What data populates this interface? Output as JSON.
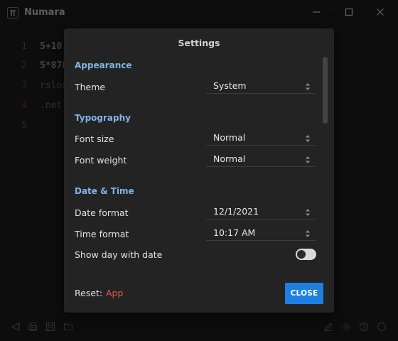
{
  "window": {
    "title": "Numara"
  },
  "editor": {
    "lines": [
      {
        "num": "1",
        "code": "5+10"
      },
      {
        "num": "2",
        "code": "5*878"
      },
      {
        "num": "3",
        "code": "rsloa"
      },
      {
        "num": "4",
        "code": ".net"
      },
      {
        "num": "5",
        "code": ""
      }
    ]
  },
  "settings": {
    "title": "Settings",
    "appearance": {
      "heading": "Appearance",
      "theme_label": "Theme",
      "theme_value": "System"
    },
    "typography": {
      "heading": "Typography",
      "font_size_label": "Font size",
      "font_size_value": "Normal",
      "font_weight_label": "Font weight",
      "font_weight_value": "Normal"
    },
    "datetime": {
      "heading": "Date & Time",
      "date_format_label": "Date format",
      "date_format_value": "12/1/2021",
      "time_format_label": "Time format",
      "time_format_value": "10:17 AM",
      "show_day_label": "Show day with date",
      "show_day_enabled": false
    },
    "footer": {
      "reset_label": "Reset:",
      "reset_app": "App",
      "close_label": "CLOSE"
    }
  },
  "colors": {
    "accent": "#1e7fe0",
    "section_heading": "#7fb4e6",
    "reset_link": "#e05a4e",
    "dialog_bg": "#232323",
    "app_bg": "#141414"
  },
  "icons": {
    "logo": "pi-icon",
    "bottom_left": [
      "send-icon",
      "print-icon",
      "save-icon",
      "folder-icon"
    ],
    "bottom_right": [
      "pencil-icon",
      "gear-icon",
      "help-icon",
      "circle-icon"
    ]
  }
}
